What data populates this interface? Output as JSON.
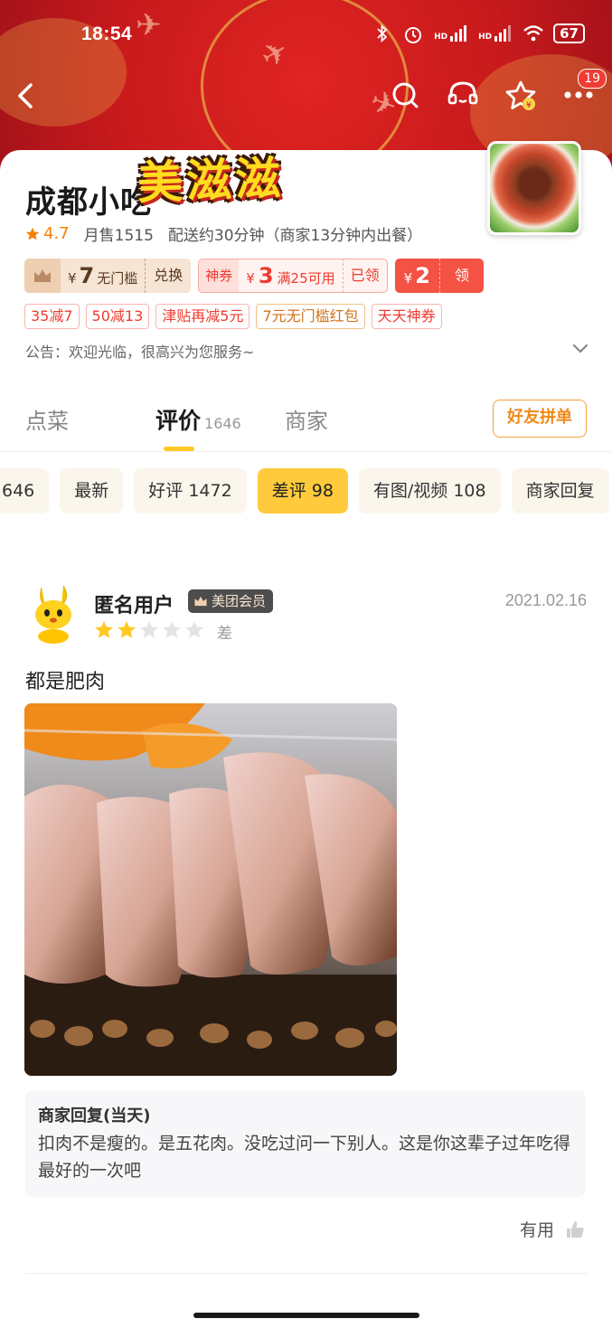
{
  "status_bar": {
    "time": "18:54",
    "battery": "67",
    "network_1": "HD",
    "network_2": "HD"
  },
  "header": {
    "notification_count": "19"
  },
  "shop": {
    "name": "成都小吃",
    "sticker_text": "美滋滋",
    "rating": "4.7",
    "monthly_sales": "月售1515",
    "delivery": "配送约30分钟（商家13分钟内出餐）",
    "notice": "公告：欢迎光临，很高兴为您服务~"
  },
  "coupons": {
    "vip": {
      "currency": "¥",
      "amount": "7",
      "desc": "无门槛",
      "action": "兑换"
    },
    "god": {
      "label": "神券",
      "currency": "¥",
      "amount": "3",
      "desc": "满25可用",
      "status": "已领"
    },
    "red": {
      "currency": "¥",
      "amount": "2",
      "action": "领"
    }
  },
  "promotions": [
    "35减7",
    "50减13",
    "津贴再减5元",
    "7元无门槛红包",
    "天天神券"
  ],
  "tabs": {
    "order": "点菜",
    "reviews": "评价",
    "reviews_count": "1646",
    "merchant": "商家",
    "group_buy": "好友拼单"
  },
  "filters": [
    "646",
    "最新",
    "好评 1472",
    "差评 98",
    "有图/视频 108",
    "商家回复"
  ],
  "review": {
    "user": "匿名用户",
    "member_tag": "美团会员",
    "date": "2021.02.16",
    "stars_filled": 2,
    "stars_total": 5,
    "rating_word": "差",
    "text": "都是肥肉",
    "reply_title": "商家回复(当天)",
    "reply_text": "扣肉不是瘦的。是五花肉。没吃过问一下别人。这是你这辈子过年吃得最好的一次吧",
    "useful": "有用"
  },
  "colors": {
    "banner_red": "#c81a1c",
    "accent_yellow": "#ffcb3c",
    "star_yellow": "#ffc823",
    "coupon_red": "#ef3b2f"
  }
}
